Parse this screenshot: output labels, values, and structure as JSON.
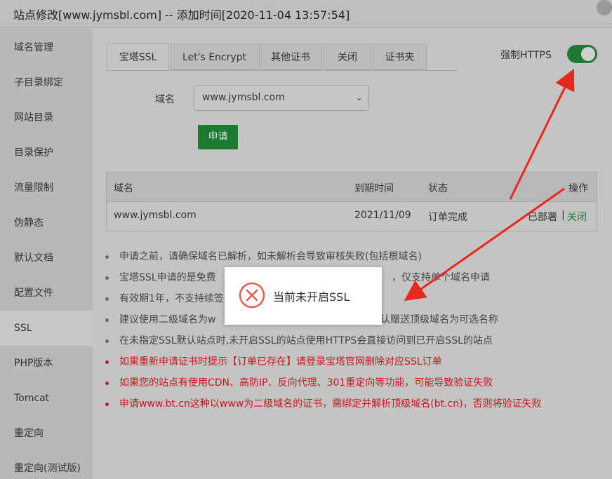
{
  "window": {
    "title": "站点修改[www.jymsbl.com] -- 添加时间[2020-11-04 13:57:54]"
  },
  "sidebar": {
    "items": [
      {
        "label": "域名管理",
        "active": false
      },
      {
        "label": "子目录绑定",
        "active": false
      },
      {
        "label": "网站目录",
        "active": false
      },
      {
        "label": "目录保护",
        "active": false
      },
      {
        "label": "流量限制",
        "active": false
      },
      {
        "label": "伪静态",
        "active": false
      },
      {
        "label": "默认文档",
        "active": false
      },
      {
        "label": "配置文件",
        "active": false
      },
      {
        "label": "SSL",
        "active": true
      },
      {
        "label": "PHP版本",
        "active": false
      },
      {
        "label": "Tomcat",
        "active": false
      },
      {
        "label": "重定向",
        "active": false
      },
      {
        "label": "重定向(测试版)",
        "active": false
      }
    ]
  },
  "tabs": [
    {
      "label": "宝塔SSL",
      "active": true
    },
    {
      "label": "Let's Encrypt",
      "active": false
    },
    {
      "label": "其他证书",
      "active": false
    },
    {
      "label": "关闭",
      "active": false
    },
    {
      "label": "证书夹",
      "active": false
    }
  ],
  "force_https": {
    "label": "强制HTTPS",
    "enabled": true,
    "color": "#1d7a32"
  },
  "domain_form": {
    "label": "域名",
    "selected": "www.jymsbl.com",
    "apply_label": "申请"
  },
  "table": {
    "headers": {
      "domain": "域名",
      "expire": "到期时间",
      "status": "状态",
      "action": "操作"
    },
    "rows": [
      {
        "domain": "www.jymsbl.com",
        "expire": "2021/11/09",
        "status": "订单完成",
        "deploy": "已部署",
        "separator": "|",
        "close": "关闭"
      }
    ]
  },
  "notes": [
    {
      "text": "申请之前，请确保域名已解析，如未解析会导致审核失败(包括根域名)",
      "type": "normal"
    },
    {
      "text": "宝塔SSL申请的是免费",
      "tail": "，仅支持单个域名申请",
      "type": "normal"
    },
    {
      "text": "有效期1年，不支持续签",
      "type": "normal"
    },
    {
      "text": "建议使用二级域名为w",
      "tail": "认赠送顶级域名为可选名称",
      "type": "normal"
    },
    {
      "text": "在未指定SSL默认站点时,未开启SSL的站点使用HTTPS会直接访问到已开启SSL的站点",
      "type": "normal"
    },
    {
      "text": "如果重新申请证书时提示【订单已存在】请登录宝塔官网删除对应SSL订单",
      "type": "red"
    },
    {
      "text": "如果您的站点有使用CDN、高防IP、反向代理、301重定向等功能，可能导致验证失败",
      "type": "red"
    },
    {
      "text": "申请www.bt.cn这种以www为二级域名的证书，需绑定并解析顶级域名(bt.cn)，否则将验证失败",
      "type": "red"
    }
  ],
  "toast": {
    "message": "当前未开启SSL",
    "icon": "error-circle-icon"
  },
  "colors": {
    "accent_green": "#1c7a31",
    "warning_red": "#c8161d",
    "annotation_arrow": "#e8271d"
  }
}
